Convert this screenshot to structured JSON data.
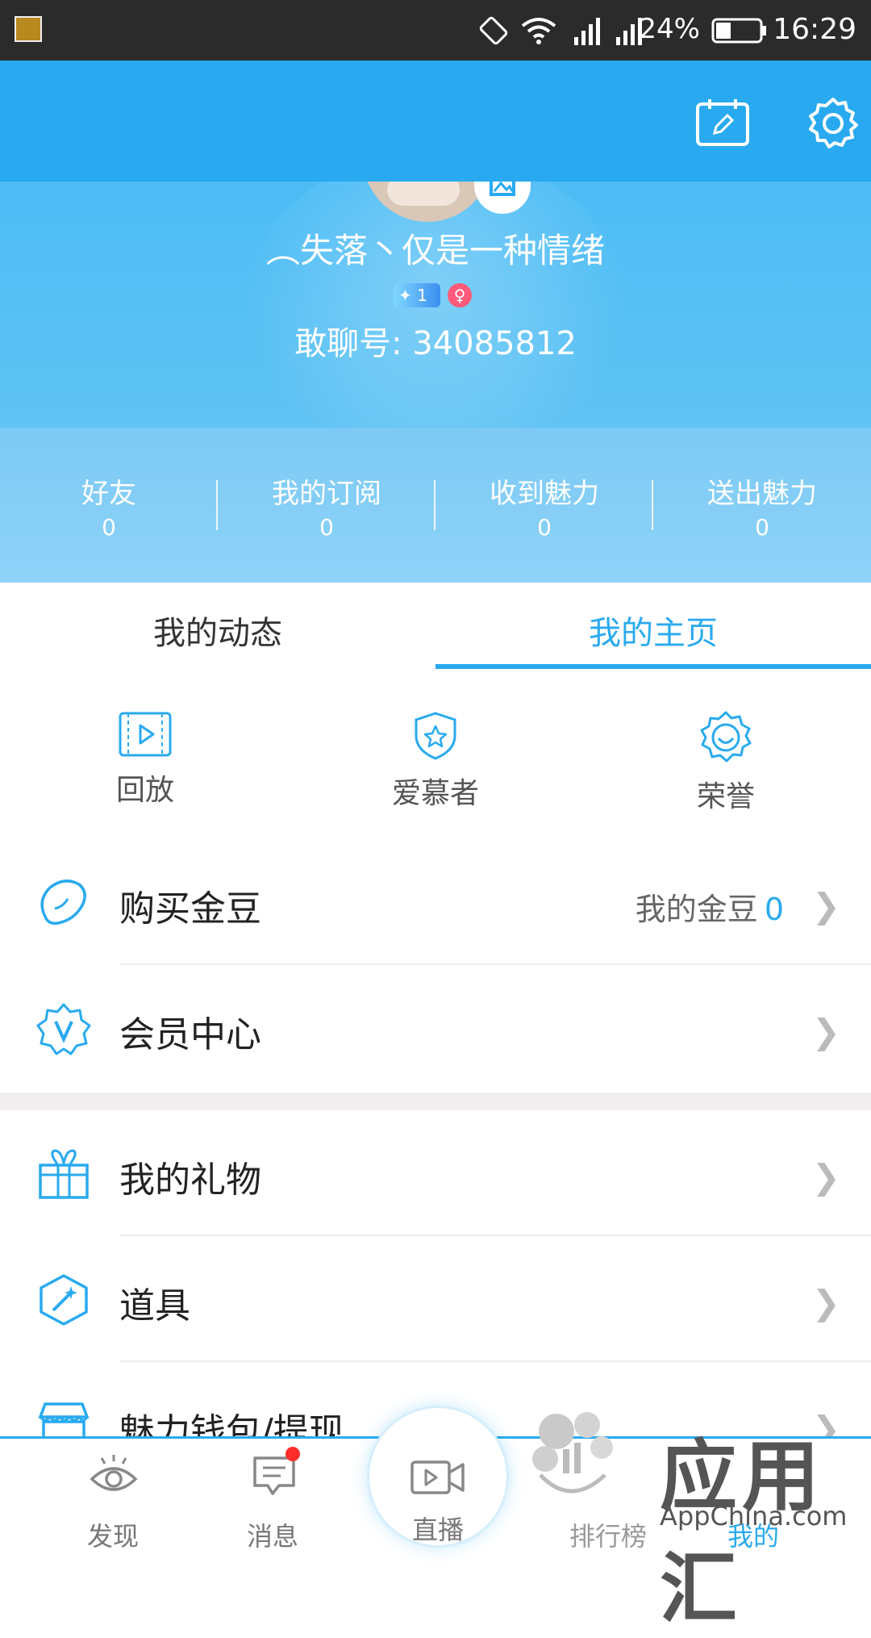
{
  "status_bar": {
    "battery": "24%",
    "time": "16:29"
  },
  "profile": {
    "nickname": "︵失落丶仅是一种情绪",
    "level": "1",
    "id_label": "敢聊号: 34085812"
  },
  "stats": [
    {
      "label": "好友",
      "value": "0"
    },
    {
      "label": "我的订阅",
      "value": "0"
    },
    {
      "label": "收到魅力",
      "value": "0"
    },
    {
      "label": "送出魅力",
      "value": "0"
    }
  ],
  "tabs": [
    {
      "label": "我的动态",
      "active": false
    },
    {
      "label": "我的主页",
      "active": true
    }
  ],
  "quick": [
    {
      "label": "回放",
      "icon": "video-play-icon"
    },
    {
      "label": "爱慕者",
      "icon": "shield-star-icon"
    },
    {
      "label": "荣誉",
      "icon": "badge-smile-icon"
    }
  ],
  "rows": [
    {
      "title": "购买金豆",
      "icon": "bean-icon"
    },
    {
      "title": "会员中心",
      "icon": "vip-icon"
    },
    {
      "title": "我的礼物",
      "icon": "gift-icon"
    },
    {
      "title": "道具",
      "icon": "magic-wand-icon"
    },
    {
      "title": "魅力钱包/提现",
      "icon": "shop-icon"
    }
  ],
  "gold": {
    "label": "我的金豆",
    "value": "0"
  },
  "nav": [
    {
      "label": "发现",
      "icon": "eye-icon"
    },
    {
      "label": "消息",
      "icon": "chat-icon"
    },
    {
      "label": "直播",
      "icon": "camera-icon"
    },
    {
      "label": "排行榜",
      "icon": "ranking-icon"
    },
    {
      "label": "我的",
      "icon": "user-icon"
    }
  ],
  "watermark": {
    "cn": "应用汇",
    "en": "AppChina.com"
  },
  "colors": {
    "accent": "#29aaf0",
    "header": "#29aaf0",
    "badge_red": "#ff2d2d"
  }
}
